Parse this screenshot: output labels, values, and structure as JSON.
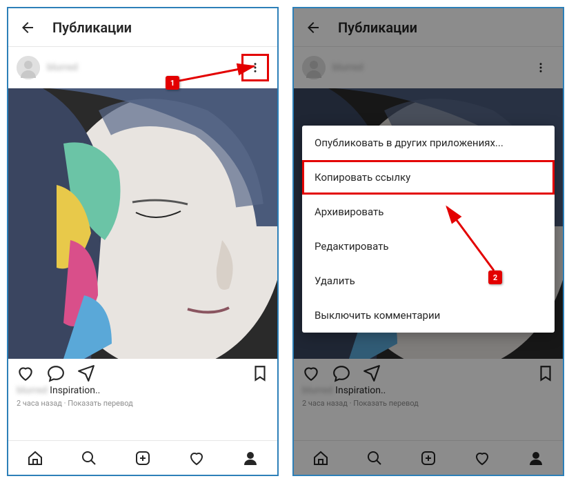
{
  "header": {
    "title": "Публикации"
  },
  "post": {
    "username": "blurred",
    "caption_user": "blurred",
    "caption_text": "Inspiration..",
    "time_text": "2 часа назад",
    "translate_text": "Показать перевод"
  },
  "menu": {
    "items": [
      "Опубликовать в других приложениях...",
      "Копировать ссылку",
      "Архивировать",
      "Редактировать",
      "Удалить",
      "Выключить комментарии"
    ]
  },
  "annotations": {
    "badge1": "1",
    "badge2": "2"
  }
}
